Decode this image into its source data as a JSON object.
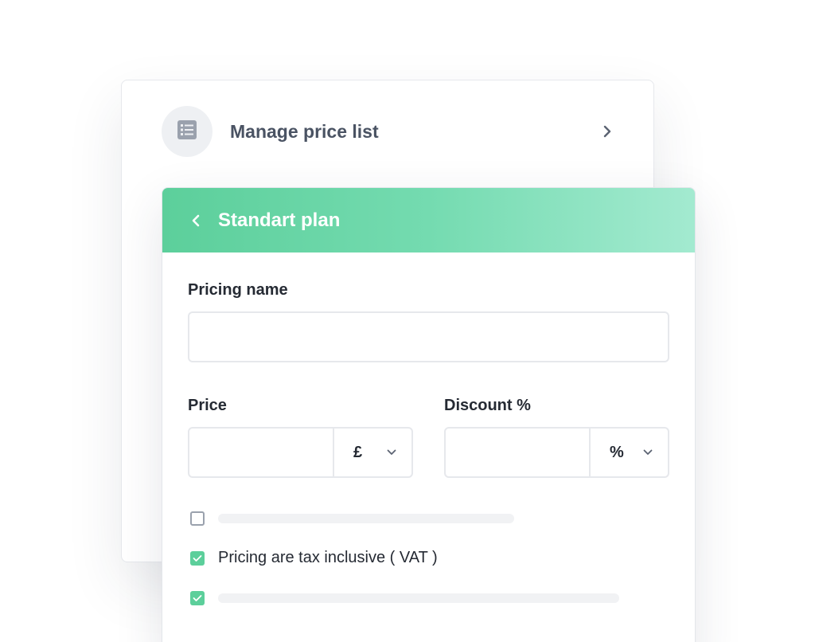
{
  "back_card": {
    "row": {
      "icon": "list-icon",
      "label": "Manage price list",
      "chevron": "chevron-right-icon"
    }
  },
  "front_card": {
    "header": {
      "back_icon": "chevron-left-icon",
      "title": "Standart plan",
      "gradient": [
        "#5ccf9b",
        "#a3ead0"
      ]
    },
    "pricing_name": {
      "label": "Pricing name",
      "value": ""
    },
    "price": {
      "label": "Price",
      "value": "",
      "currency": "£"
    },
    "discount": {
      "label": "Discount %",
      "value": "",
      "unit": "%"
    },
    "options": [
      {
        "checked": false,
        "label": ""
      },
      {
        "checked": true,
        "label": "Pricing are tax inclusive ( VAT )"
      },
      {
        "checked": true,
        "label": ""
      }
    ]
  },
  "colors": {
    "accent": "#5ccf9b",
    "text": "#252a33",
    "muted": "#4a5363",
    "border": "#e6e8ec"
  }
}
